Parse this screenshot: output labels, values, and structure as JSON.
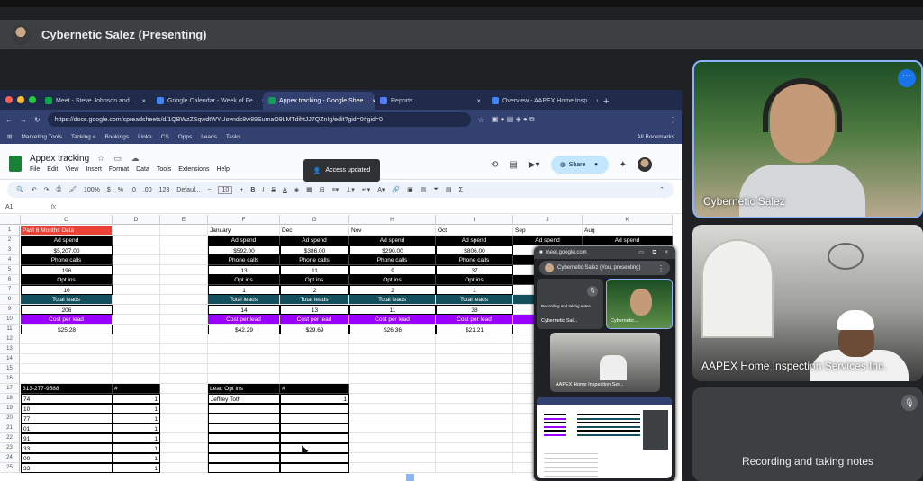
{
  "presenter": {
    "name": "Cybernetic Salez (Presenting)"
  },
  "browser": {
    "tabs": [
      {
        "label": "Meet - Steve Johnson and ...",
        "color": "#00ac47",
        "active": false
      },
      {
        "label": "Google Calendar - Week of Fe...",
        "color": "#4285f4",
        "active": false
      },
      {
        "label": "Appex tracking - Google Shee...",
        "color": "#0f9d58",
        "active": true
      },
      {
        "label": "Reports",
        "color": "#4e7cff",
        "active": false
      },
      {
        "label": "Overview - AAPEX Home Insp...",
        "color": "#4285f4",
        "active": false
      }
    ],
    "new_tab": "+",
    "url": "https://docs.google.com/spreadsheets/d/1QBWzZSqwdtWYUovnds8w89SumaO9LMTdihtJJ7QZnIg/edit?gid=0#gid=0",
    "bookmarks": [
      "Marketing Tools",
      "Tacking #",
      "Bookings",
      "Linke",
      "CS",
      "Opps",
      "Leads",
      "Tasks"
    ],
    "all_bookmarks": "All Bookmarks"
  },
  "sheets": {
    "title": "Appex tracking",
    "menus": [
      "File",
      "Edit",
      "View",
      "Insert",
      "Format",
      "Data",
      "Tools",
      "Extensions",
      "Help"
    ],
    "toast": "Access updated",
    "share": "Share",
    "toolbar": {
      "zoom": "100%",
      "currency": "$",
      "percent": "%",
      "dec_minus": ".0",
      "dec_plus": ".00",
      "number": "123",
      "font": "Defaul...",
      "font_size": "10"
    },
    "name_box": "A1",
    "fx": "fx",
    "columns": [
      "C",
      "D",
      "E",
      "F",
      "G",
      "H",
      "I",
      "J",
      "K"
    ],
    "rows": [
      "1",
      "2",
      "3",
      "4",
      "5",
      "6",
      "7",
      "8",
      "9",
      "10",
      "11",
      "12",
      "13",
      "14",
      "15",
      "16",
      "17",
      "18",
      "19",
      "20",
      "21",
      "22",
      "23",
      "24",
      "25"
    ],
    "months": {
      "F": "January",
      "G": "Dec",
      "H": "Nov",
      "I": "Oct",
      "J": "Sep",
      "K": "Aug"
    },
    "past_label": "Past 6 Months Data",
    "blocks": {
      "ad_spend": "Ad spend",
      "phone_calls": "Phone calls",
      "opt_ins": "Opt ins",
      "total_leads": "Total leads",
      "cost_per_lead": "Cost per lead"
    },
    "summary": {
      "ad_spend": "$5,207.00",
      "phone_calls": "196",
      "opt_ins": "10",
      "total_leads": "206",
      "cost_per_lead": "$25.28"
    },
    "monthly": [
      {
        "col": "F",
        "ad_spend": "$592.00",
        "phone_calls": "13",
        "opt_ins": "1",
        "total_leads": "14",
        "cost_per_lead": "$42.29"
      },
      {
        "col": "G",
        "ad_spend": "$386.00",
        "phone_calls": "11",
        "opt_ins": "2",
        "total_leads": "13",
        "cost_per_lead": "$29.69"
      },
      {
        "col": "H",
        "ad_spend": "$290.00",
        "phone_calls": "9",
        "opt_ins": "2",
        "total_leads": "11",
        "cost_per_lead": "$26.36"
      },
      {
        "col": "I",
        "ad_spend": "$806.00",
        "phone_calls": "37",
        "opt_ins": "1",
        "total_leads": "38",
        "cost_per_lead": "$21.21"
      }
    ],
    "phone_table": {
      "header": "313-277-9588",
      "count_header": "#",
      "rows": [
        [
          "74",
          "1"
        ],
        [
          "10",
          "1"
        ],
        [
          "77",
          "1"
        ],
        [
          "01",
          "1"
        ],
        [
          "91",
          "1"
        ],
        [
          "33",
          "1"
        ],
        [
          "00",
          "1"
        ],
        [
          "33",
          "1"
        ]
      ]
    },
    "lead_table": {
      "header": "Lead Opt ins",
      "count_header": "#",
      "rows": [
        [
          "Jeffrey Toth",
          "1"
        ]
      ]
    }
  },
  "pip": {
    "site": "meet.google.com",
    "presenting": "Cybernetic Salez (You, presenting)",
    "tile1_label": "Cybernetic Sal...",
    "tile1_sub": "Recording and taking notes",
    "tile2_label": "Cybernetic...",
    "tile3_label": "AAPEX Home Inspection Ser..."
  },
  "participants": [
    {
      "name": "Cybernetic Salez"
    },
    {
      "name": "AAPEX Home Inspection Services Inc."
    },
    {
      "name": "Recording and taking notes"
    }
  ]
}
